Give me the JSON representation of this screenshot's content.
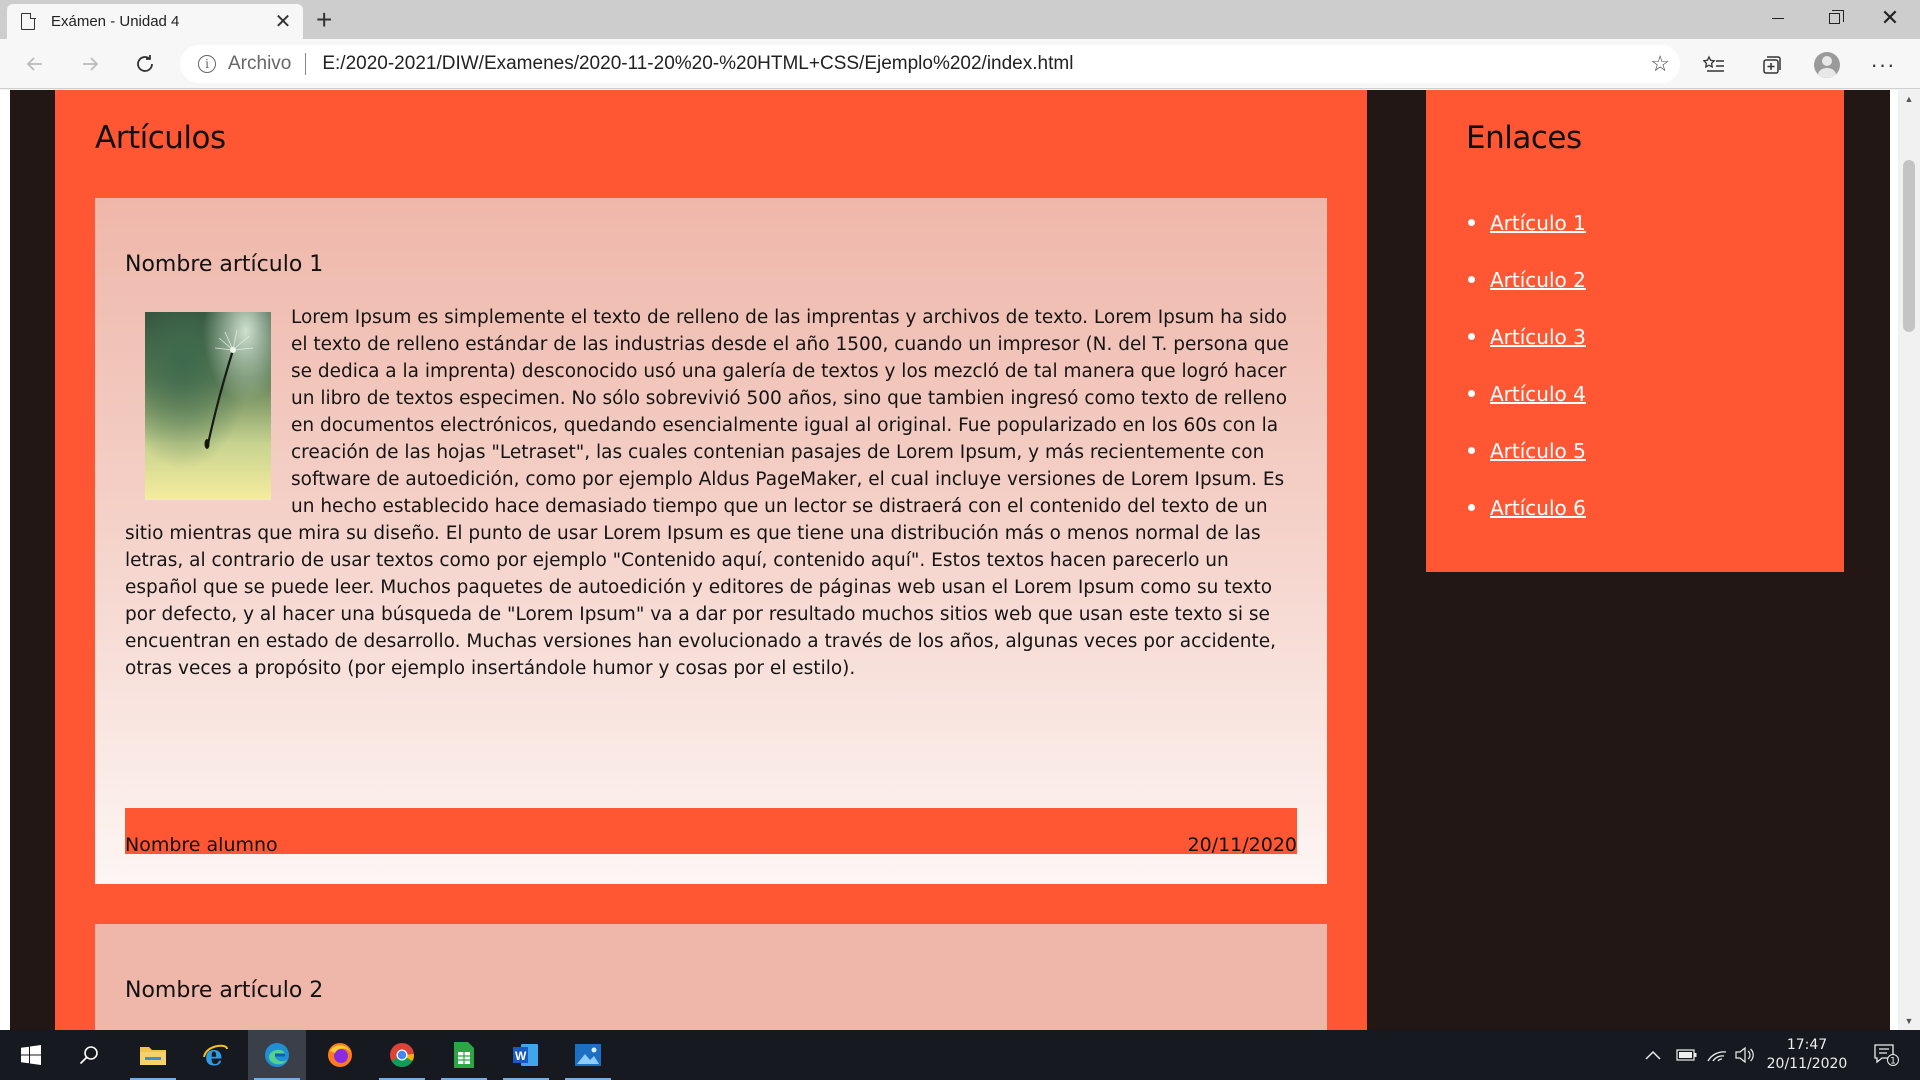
{
  "browser": {
    "tab_title": "Exámen - Unidad 4",
    "tab_close": "✕",
    "new_tab": "+",
    "site_label": "Archivo",
    "url": "E:/2020-2021/DIW/Examenes/2020-11-20%20-%20HTML+CSS/Ejemplo%202/index.html",
    "more_menu": "···"
  },
  "main": {
    "title": "Artículos",
    "articles": [
      {
        "title": "Nombre artículo 1",
        "body": "Lorem Ipsum es simplemente el texto de relleno de las imprentas y archivos de texto. Lorem Ipsum ha sido el texto de relleno estándar de las industrias desde el año 1500, cuando un impresor (N. del T. persona que se dedica a la imprenta) desconocido usó una galería de textos y los mezcló de tal manera que logró hacer un libro de textos especimen. No sólo sobrevivió 500 años, sino que tambien ingresó como texto de relleno en documentos electrónicos, quedando esencialmente igual al original. Fue popularizado en los 60s con la creación de las hojas \"Letraset\", las cuales contenian pasajes de Lorem Ipsum, y más recientemente con software de autoedición, como por ejemplo Aldus PageMaker, el cual incluye versiones de Lorem Ipsum. Es un hecho establecido hace demasiado tiempo que un lector se distraerá con el contenido del texto de un sitio mientras que mira su diseño. El punto de usar Lorem Ipsum es que tiene una distribución más o menos normal de las letras, al contrario de usar textos como por ejemplo \"Contenido aquí, contenido aquí\". Estos textos hacen parecerlo un español que se puede leer. Muchos paquetes de autoedición y editores de páginas web usan el Lorem Ipsum como su texto por defecto, y al hacer una búsqueda de \"Lorem Ipsum\" va a dar por resultado muchos sitios web que usan este texto si se encuentran en estado de desarrollo. Muchas versiones han evolucionado a través de los años, algunas veces por accidente, otras veces a propósito (por ejemplo insertándole humor y cosas por el estilo).",
        "author": "Nombre alumno",
        "date": "20/11/2020"
      },
      {
        "title": "Nombre artículo 2"
      }
    ]
  },
  "sidebar": {
    "title": "Enlaces",
    "links": [
      "Artículo 1",
      "Artículo 2",
      "Artículo 3",
      "Artículo 4",
      "Artículo 5",
      "Artículo 6"
    ]
  },
  "taskbar": {
    "time": "17:47",
    "date": "20/11/2020",
    "notification_count": "1"
  },
  "colors": {
    "accent": "#ff5733",
    "page_background": "#231715",
    "article_background": "#efb7aa",
    "link": "#ffffff"
  }
}
